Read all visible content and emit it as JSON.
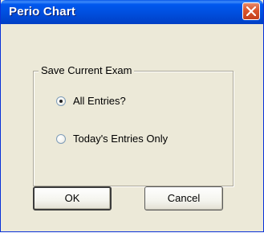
{
  "window": {
    "title": "Perio Chart",
    "close_icon": "close-icon"
  },
  "group": {
    "legend": "Save Current Exam",
    "options": [
      {
        "label": "All Entries?",
        "checked": true
      },
      {
        "label": "Today's Entries Only",
        "checked": false
      }
    ]
  },
  "buttons": {
    "ok_label": "OK",
    "cancel_label": "Cancel"
  },
  "colors": {
    "titlebar": "#0050e0",
    "close_button": "#d9542b",
    "dialog_background": "#ece9d8"
  }
}
